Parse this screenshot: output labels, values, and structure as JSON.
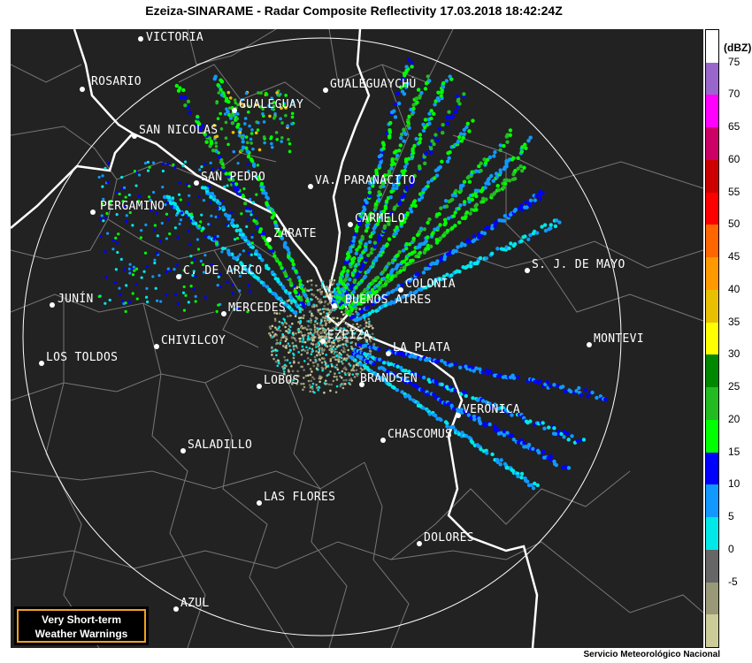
{
  "title": "Ezeiza-SINARAME - Radar Composite Reflectivity 17.03.2018  18:42:24Z",
  "footer": "Servicio Meteorológico Nacional",
  "warning_button": {
    "line1": "Very Short-term",
    "line2": "Weather Warnings"
  },
  "legend": {
    "unit": "(dBZ)",
    "ticks": [
      "75",
      "70",
      "65",
      "60",
      "55",
      "50",
      "45",
      "40",
      "35",
      "30",
      "25",
      "20",
      "15",
      "10",
      "5",
      "0",
      "-5"
    ],
    "colors": [
      "#ffffff",
      "#9966cc",
      "#ff00ff",
      "#cc0066",
      "#cc0000",
      "#ff0000",
      "#ff6600",
      "#ff9900",
      "#e8c000",
      "#ffff00",
      "#008800",
      "#22bb22",
      "#00ff00",
      "#0000ff",
      "#1199ff",
      "#00e8e8",
      "#666666",
      "#999977",
      "#cccc99"
    ]
  },
  "cities": [
    {
      "name": "VICTORIA",
      "label": "VICTORIA"
    },
    {
      "name": "ROSARIO",
      "label": "ROSARIO"
    },
    {
      "name": "GUALEGUAY",
      "label": "GUALEGUAY"
    },
    {
      "name": "GUALEGUAYCHU",
      "label": "GUALEGUAYCHÚ"
    },
    {
      "name": "SAN-NICOLAS",
      "label": "SAN NICOLAS"
    },
    {
      "name": "SAN-PEDRO",
      "label": "SAN PEDRO"
    },
    {
      "name": "VA-PARANACITO",
      "label": "VA. PARANACITO"
    },
    {
      "name": "PERGAMINO",
      "label": "PERGAMINO"
    },
    {
      "name": "CARMELO",
      "label": "CARMELO"
    },
    {
      "name": "ZARATE",
      "label": "ZARATE"
    },
    {
      "name": "SJ-DE-MAYO",
      "label": "S. J. DE MAYO"
    },
    {
      "name": "C-DE-ARECO",
      "label": "C. DE ARECO"
    },
    {
      "name": "COLONIA",
      "label": "COLONIA"
    },
    {
      "name": "JUNIN",
      "label": "JUNÍN"
    },
    {
      "name": "BUENOS-AIRES",
      "label": "BUENOS AIRES"
    },
    {
      "name": "MERCEDES",
      "label": "MERCEDES"
    },
    {
      "name": "EZEIZA",
      "label": "EZEIZA"
    },
    {
      "name": "MONTEVIDEO",
      "label": "MONTEVI"
    },
    {
      "name": "CHIVILCOY",
      "label": "CHIVILCOY"
    },
    {
      "name": "LA-PLATA",
      "label": "LA PLATA"
    },
    {
      "name": "LOS-TOLDOS",
      "label": "LOS TOLDOS"
    },
    {
      "name": "LOBOS",
      "label": "LOBOS"
    },
    {
      "name": "BRANDSEN",
      "label": "BRANDSEN"
    },
    {
      "name": "VERONICA",
      "label": "VERÓNICA"
    },
    {
      "name": "CHASCOMUS",
      "label": "CHASCOMUS"
    },
    {
      "name": "SALADILLO",
      "label": "SALADILLO"
    },
    {
      "name": "LAS-FLORES",
      "label": "LAS FLORES"
    },
    {
      "name": "DOLORES",
      "label": "DOLORES"
    },
    {
      "name": "AZUL",
      "label": "AZUL"
    }
  ]
}
